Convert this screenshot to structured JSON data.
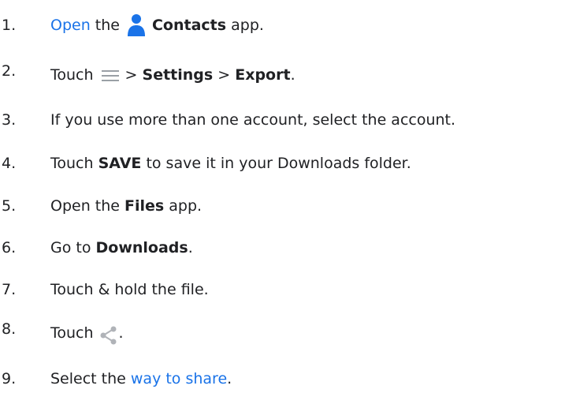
{
  "steps": [
    {
      "number": "1.",
      "parts": {
        "link": "Open",
        "text1": "the",
        "bold": "Contacts",
        "text2": "app."
      },
      "icon": "contacts-person-icon"
    },
    {
      "number": "2.",
      "parts": {
        "text1": "Touch",
        "sep1": ">",
        "bold1": "Settings",
        "sep2": ">",
        "bold2": "Export",
        "end": "."
      },
      "icon": "menu-icon"
    },
    {
      "number": "3.",
      "text": "If you use more than one account, select the account."
    },
    {
      "number": "4.",
      "parts": {
        "text1": "Touch",
        "bold": "SAVE",
        "text2": "to save it in your Downloads folder."
      }
    },
    {
      "number": "5.",
      "parts": {
        "text1": "Open the",
        "bold": "Files",
        "text2": "app."
      }
    },
    {
      "number": "6.",
      "parts": {
        "text1": "Go to",
        "bold": "Downloads",
        "end": "."
      }
    },
    {
      "number": "7.",
      "text": "Touch & hold the file."
    },
    {
      "number": "8.",
      "parts": {
        "text1": "Touch",
        "end": "."
      },
      "icon": "share-icon"
    },
    {
      "number": "9.",
      "parts": {
        "text1": "Select the",
        "link": "way to share",
        "end": "."
      }
    }
  ],
  "colors": {
    "text": "#202124",
    "link": "#1a73e8",
    "contacts_icon": "#1a73e8",
    "menu_icon": "#9aa0a6",
    "share_icon": "#b0b3b8"
  }
}
